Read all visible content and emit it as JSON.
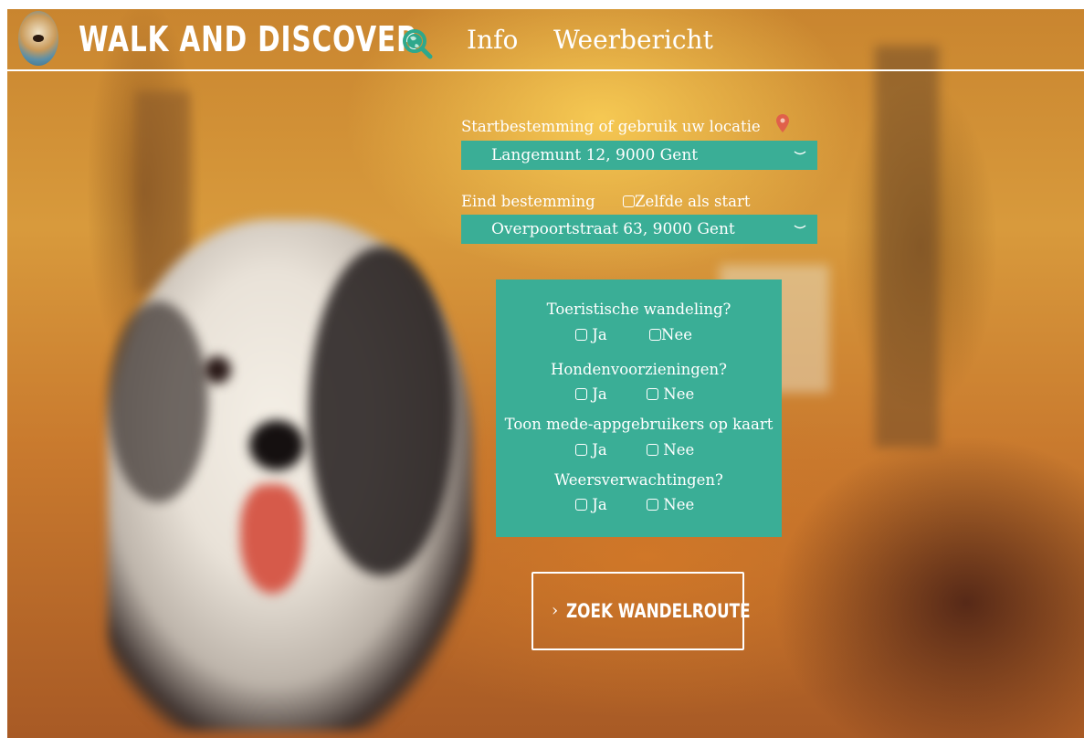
{
  "header": {
    "brand": "Walk and Discover",
    "nav": {
      "info": "Info",
      "weather": "Weerbericht"
    }
  },
  "start": {
    "label": "Startbestemming of gebruik uw locatie",
    "value": "Langemunt 12, 9000 Gent"
  },
  "end": {
    "label": "Eind bestemming",
    "same_as_start": "Zelfde als start",
    "value": "Overpoortstraat 63, 9000 Gent"
  },
  "options": {
    "tourist": {
      "question": "Toeristische wandeling?",
      "yes": "Ja",
      "no": "Nee"
    },
    "dogs": {
      "question": "Hondenvoorzieningen?",
      "yes": "Ja",
      "no": "Nee"
    },
    "users": {
      "question": "Toon mede-appgebruikers op kaart",
      "yes": "Ja",
      "no": "Nee"
    },
    "weather": {
      "question": "Weersverwachtingen?",
      "yes": "Ja",
      "no": "Nee"
    }
  },
  "search_button": {
    "arrow": "›",
    "label": "Zoek wandelroute"
  },
  "colors": {
    "accent": "#3aae96",
    "pin": "#e0604a"
  },
  "icons": {
    "brand": "globe-search-icon",
    "location": "location-pin-icon",
    "dropdown": "chevron-down-icon"
  }
}
